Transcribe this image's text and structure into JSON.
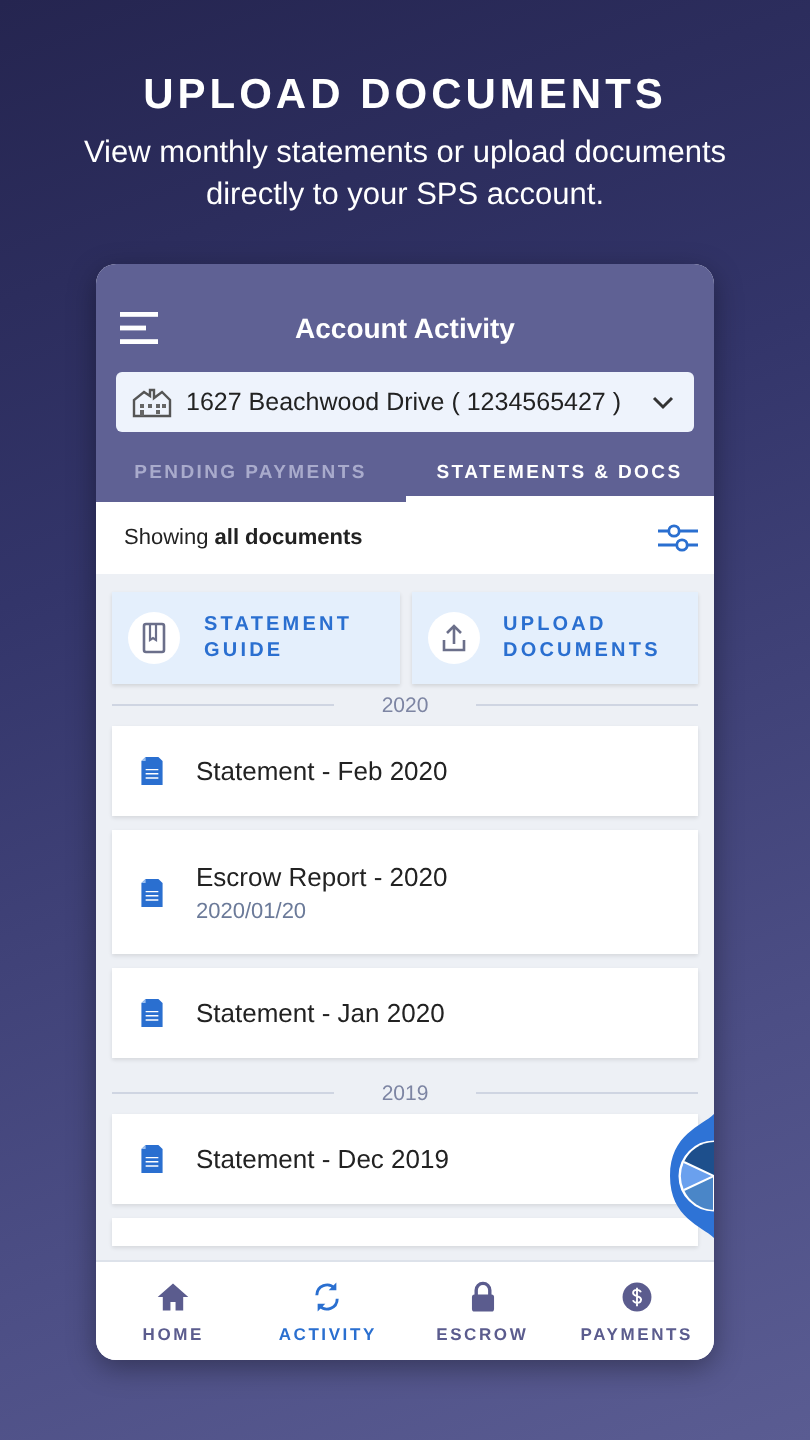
{
  "promo": {
    "headline": "UPLOAD DOCUMENTS",
    "subtitle": "View monthly statements or upload documents directly to your SPS account."
  },
  "header": {
    "title": "Account Activity"
  },
  "account_selector": {
    "value": "1627 Beachwood Drive ( 1234565427 )"
  },
  "tabs": [
    {
      "label": "PENDING PAYMENTS",
      "selected": false
    },
    {
      "label": "STATEMENTS & DOCS",
      "selected": true
    }
  ],
  "filter": {
    "text": "Showing **all documents**"
  },
  "actions": [
    {
      "label": "STATEMENT GUIDE"
    },
    {
      "label": "UPLOAD DOCUMENTS"
    }
  ],
  "sections": [
    {
      "year": "2020",
      "documents": [
        {
          "title": "Statement - Feb 2020"
        },
        {
          "title": "Escrow Report - 2020",
          "date": "2020/01/20"
        },
        {
          "title": "Statement - Jan 2020"
        }
      ]
    },
    {
      "year": "2019",
      "documents": [
        {
          "title": "Statement - Dec 2019"
        }
      ]
    }
  ],
  "bottom_nav": [
    {
      "label": "HOME",
      "selected": false
    },
    {
      "label": "ACTIVITY",
      "selected": true
    },
    {
      "label": "ESCROW",
      "selected": false
    },
    {
      "label": "PAYMENTS",
      "selected": false
    }
  ]
}
